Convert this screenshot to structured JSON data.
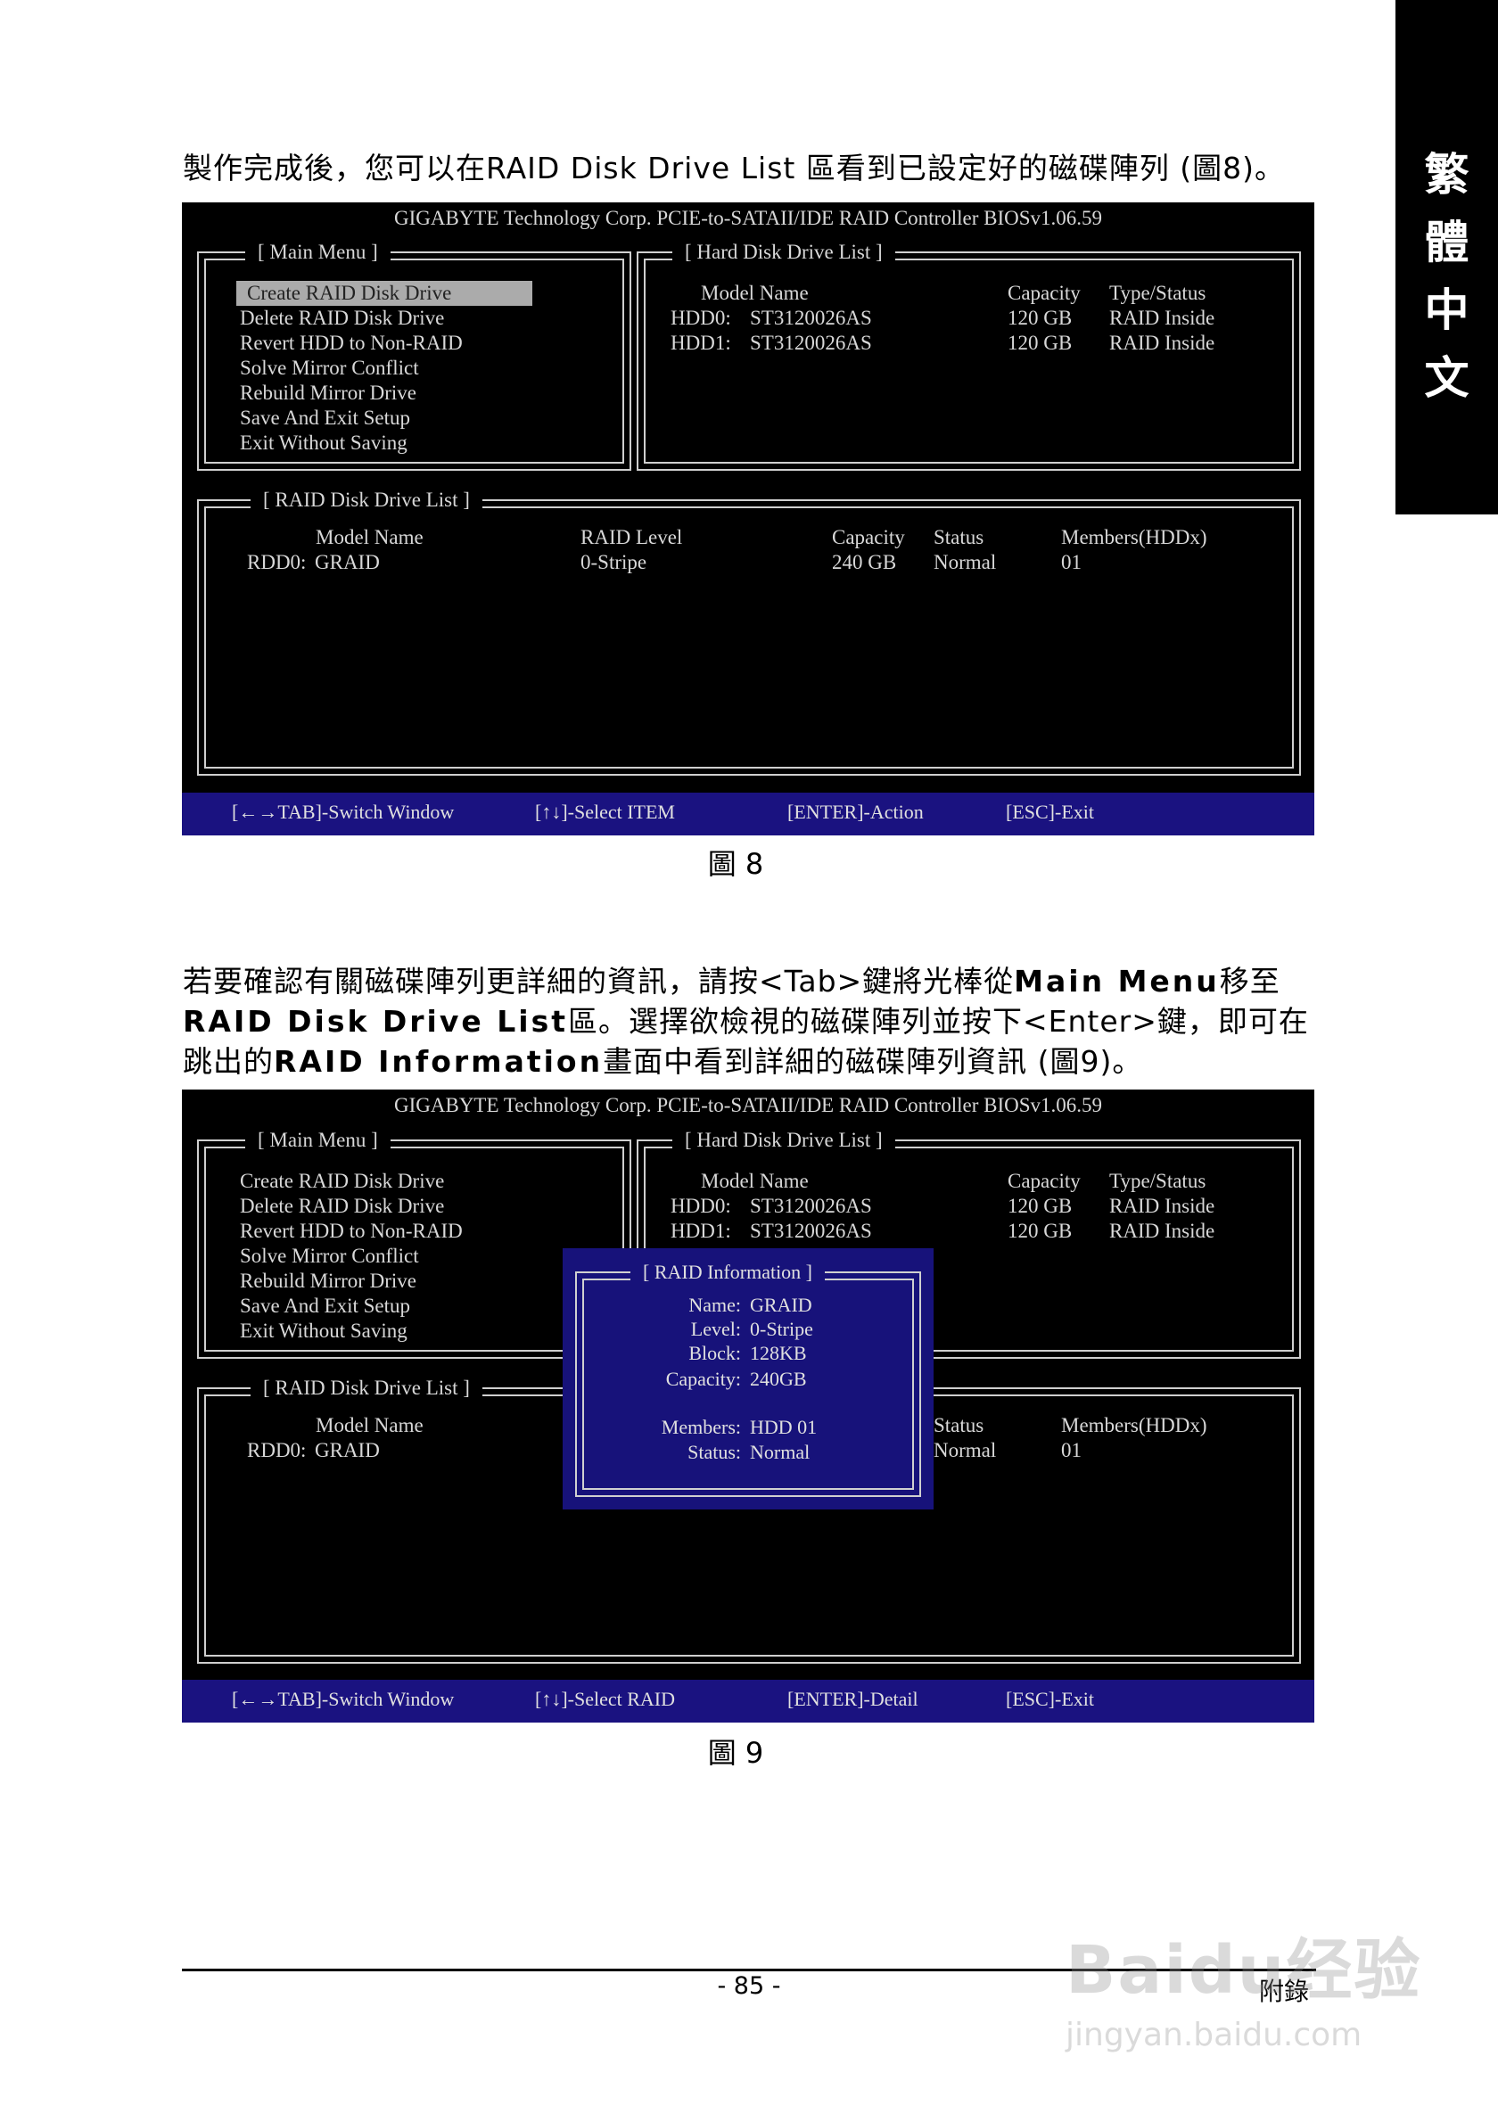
{
  "side_tab": [
    "繁",
    "體",
    "中",
    "文"
  ],
  "para1": "製作完成後，您可以在RAID Disk Drive List 區看到已設定好的磁碟陣列 (圖8)。",
  "para2": {
    "t1": "若要確認有關磁碟陣列更詳細的資訊，請按<Tab>鍵將光棒從",
    "b1": "Main Menu",
    "t2": "移至",
    "b2": "RAID Disk Drive List",
    "t3": "區。選擇欲檢視的磁碟陣列並按下<Enter>鍵，即可在跳出的",
    "b3": "RAID Information",
    "t4": "畫面中看到詳細的磁碟陣列資訊 (圖9)。"
  },
  "bios_title": "GIGABYTE Technology Corp. PCIE-to-SATAII/IDE RAID Controller BIOSv1.06.59",
  "main_menu": {
    "title": "[ Main Menu ]",
    "items": [
      "Create RAID Disk Drive",
      "Delete RAID Disk Drive",
      "Revert HDD to Non-RAID",
      "Solve Mirror Conflict",
      "Rebuild Mirror Drive",
      "Save And Exit Setup",
      "Exit Without Saving"
    ]
  },
  "hdd_list": {
    "title": "[ Hard Disk Drive List ]",
    "headers": {
      "model": "Model Name",
      "capacity": "Capacity",
      "type": "Type/Status"
    },
    "rows": [
      {
        "id": "HDD0:",
        "model": "ST3120026AS",
        "capacity": "120 GB",
        "type": "RAID Inside"
      },
      {
        "id": "HDD1:",
        "model": "ST3120026AS",
        "capacity": "120 GB",
        "type": "RAID Inside"
      }
    ]
  },
  "raid_list": {
    "title": "[ RAID Disk Drive List ]",
    "headers": {
      "model": "Model Name",
      "level": "RAID Level",
      "capacity": "Capacity",
      "status": "Status",
      "members": "Members(HDDx)"
    },
    "rows": [
      {
        "id": "RDD0:",
        "model": "GRAID",
        "level": "0-Stripe",
        "capacity": "240 GB",
        "status": "Normal",
        "members": "01"
      }
    ]
  },
  "status_bar_1": {
    "switch": "[←→TAB]-Switch Window",
    "select": "[↑↓]-Select ITEM",
    "enter": "[ENTER]-Action",
    "esc": "[ESC]-Exit"
  },
  "status_bar_2": {
    "switch": "[←→TAB]-Switch Window",
    "select": "[↑↓]-Select RAID",
    "enter": "[ENTER]-Detail",
    "esc": "[ESC]-Exit"
  },
  "raid_info": {
    "title": "[ RAID Information ]",
    "name_label": "Name:",
    "name": "GRAID",
    "level_label": "Level:",
    "level": "0-Stripe",
    "block_label": "Block:",
    "block": "128KB",
    "capacity_label": "Capacity:",
    "capacity": "240GB",
    "members_label": "Members:",
    "members": "HDD 01",
    "status_label": "Status:",
    "status": "Normal"
  },
  "caption1": "圖 8",
  "caption2": "圖 9",
  "page_number": "- 85 -",
  "appendix": "附錄",
  "watermark": {
    "main": "Baidu经验",
    "sub": "jingyan.baidu.com"
  }
}
